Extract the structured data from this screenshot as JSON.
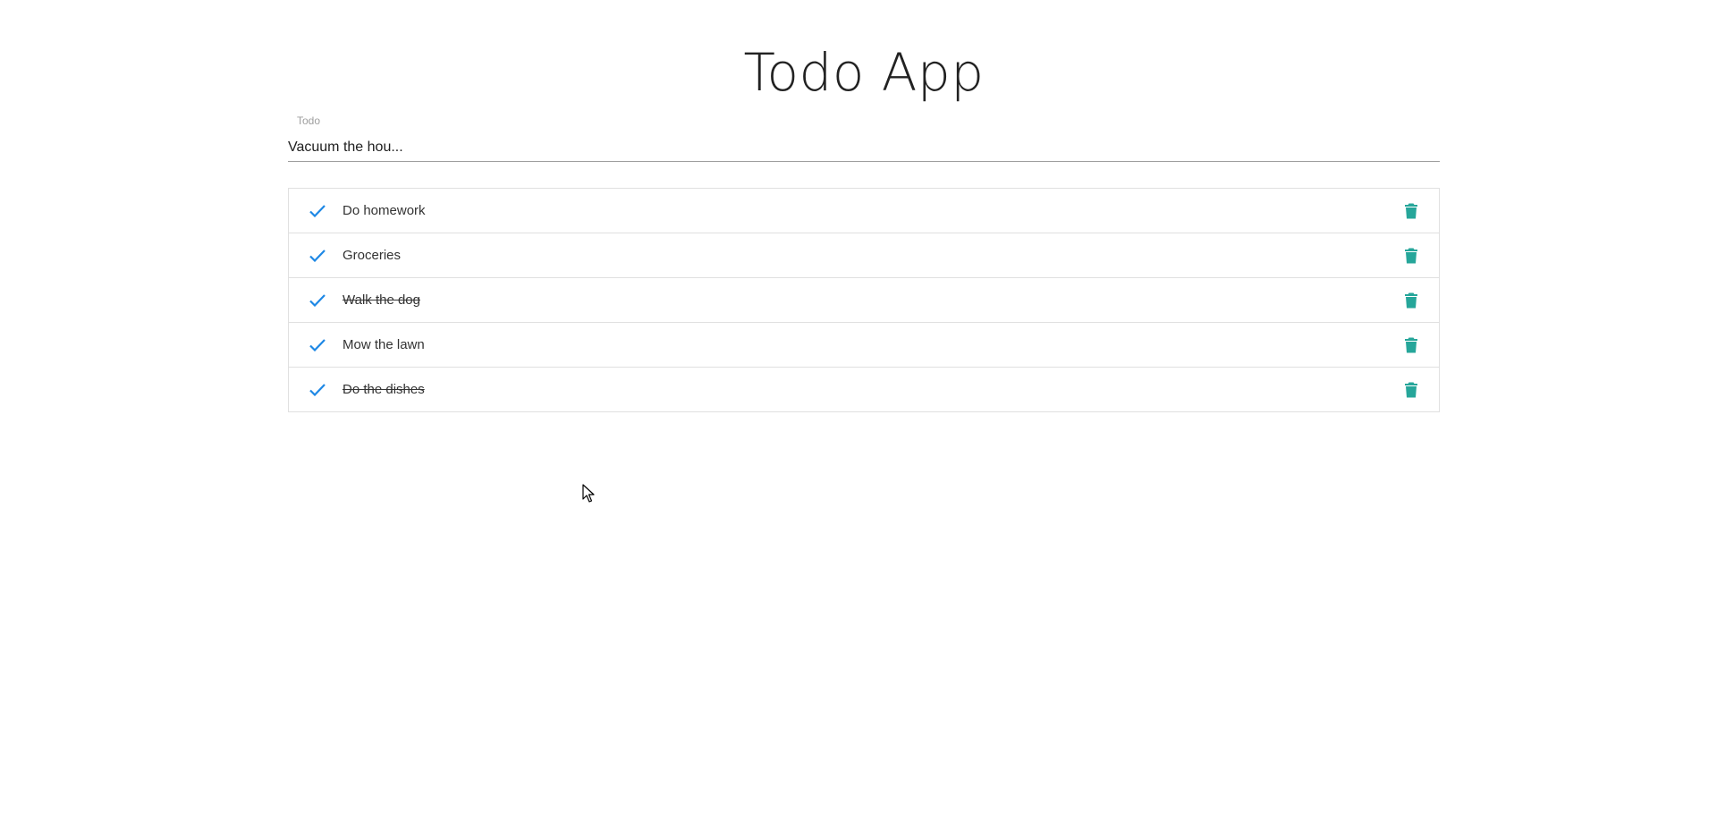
{
  "app": {
    "title": "Todo App"
  },
  "input": {
    "label": "Todo",
    "value": "Vacuum the hou..."
  },
  "todos": [
    {
      "text": "Do homework",
      "done": false
    },
    {
      "text": "Groceries",
      "done": false
    },
    {
      "text": "Walk the dog",
      "done": true
    },
    {
      "text": "Mow the lawn",
      "done": false
    },
    {
      "text": "Do the dishes",
      "done": true
    }
  ],
  "colors": {
    "check": "#1e88e5",
    "delete": "#26a69a"
  },
  "icons": {
    "check": "check-icon",
    "delete": "trash-icon"
  }
}
